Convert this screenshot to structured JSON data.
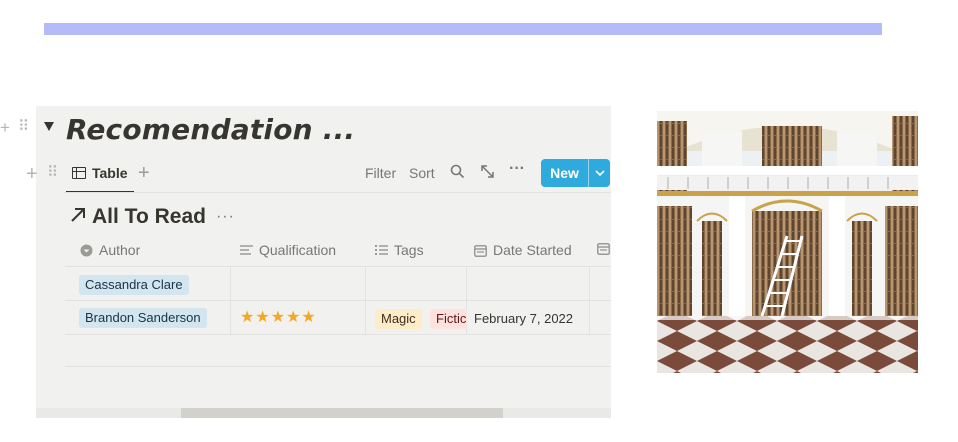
{
  "page": {
    "title": "Recomendation ...",
    "banner_color": "#b3bcf7"
  },
  "gutter": {
    "add_icon": "plus-icon",
    "drag_icon": "drag-handle-icon",
    "toggle_icon": "triangle-down-icon"
  },
  "view_tabs": {
    "active_tab": "Table",
    "tab_icon": "table-icon",
    "add_view_icon": "plus-icon"
  },
  "toolbar": {
    "filter": "Filter",
    "sort": "Sort",
    "search_icon": "search-icon",
    "expand_icon": "expand-icon",
    "more_icon": "more-horizontal-icon",
    "new_label": "New",
    "new_button_color": "#2eaadc"
  },
  "database": {
    "title": "All To Read",
    "link_icon": "arrow-up-right-icon",
    "more_icon": "ellipsis-icon"
  },
  "table": {
    "columns": [
      {
        "label": "Author",
        "icon": "person-icon"
      },
      {
        "label": "Qualification",
        "icon": "text-lines-icon"
      },
      {
        "label": "Tags",
        "icon": "list-icon"
      },
      {
        "label": "Date Started",
        "icon": "calendar-icon"
      },
      {
        "label": "",
        "icon": "calendar-icon"
      }
    ],
    "rows": [
      {
        "author": "Cassandra Clare",
        "rating": 0,
        "tags": [],
        "date_started": ""
      },
      {
        "author": "Brandon Sanderson",
        "rating": 5,
        "stars": "★★★★★",
        "tags": [
          "Magic",
          "Fictic"
        ],
        "date_started": "February 7, 2022"
      }
    ]
  },
  "cover_image": {
    "icon": "library-photo"
  }
}
